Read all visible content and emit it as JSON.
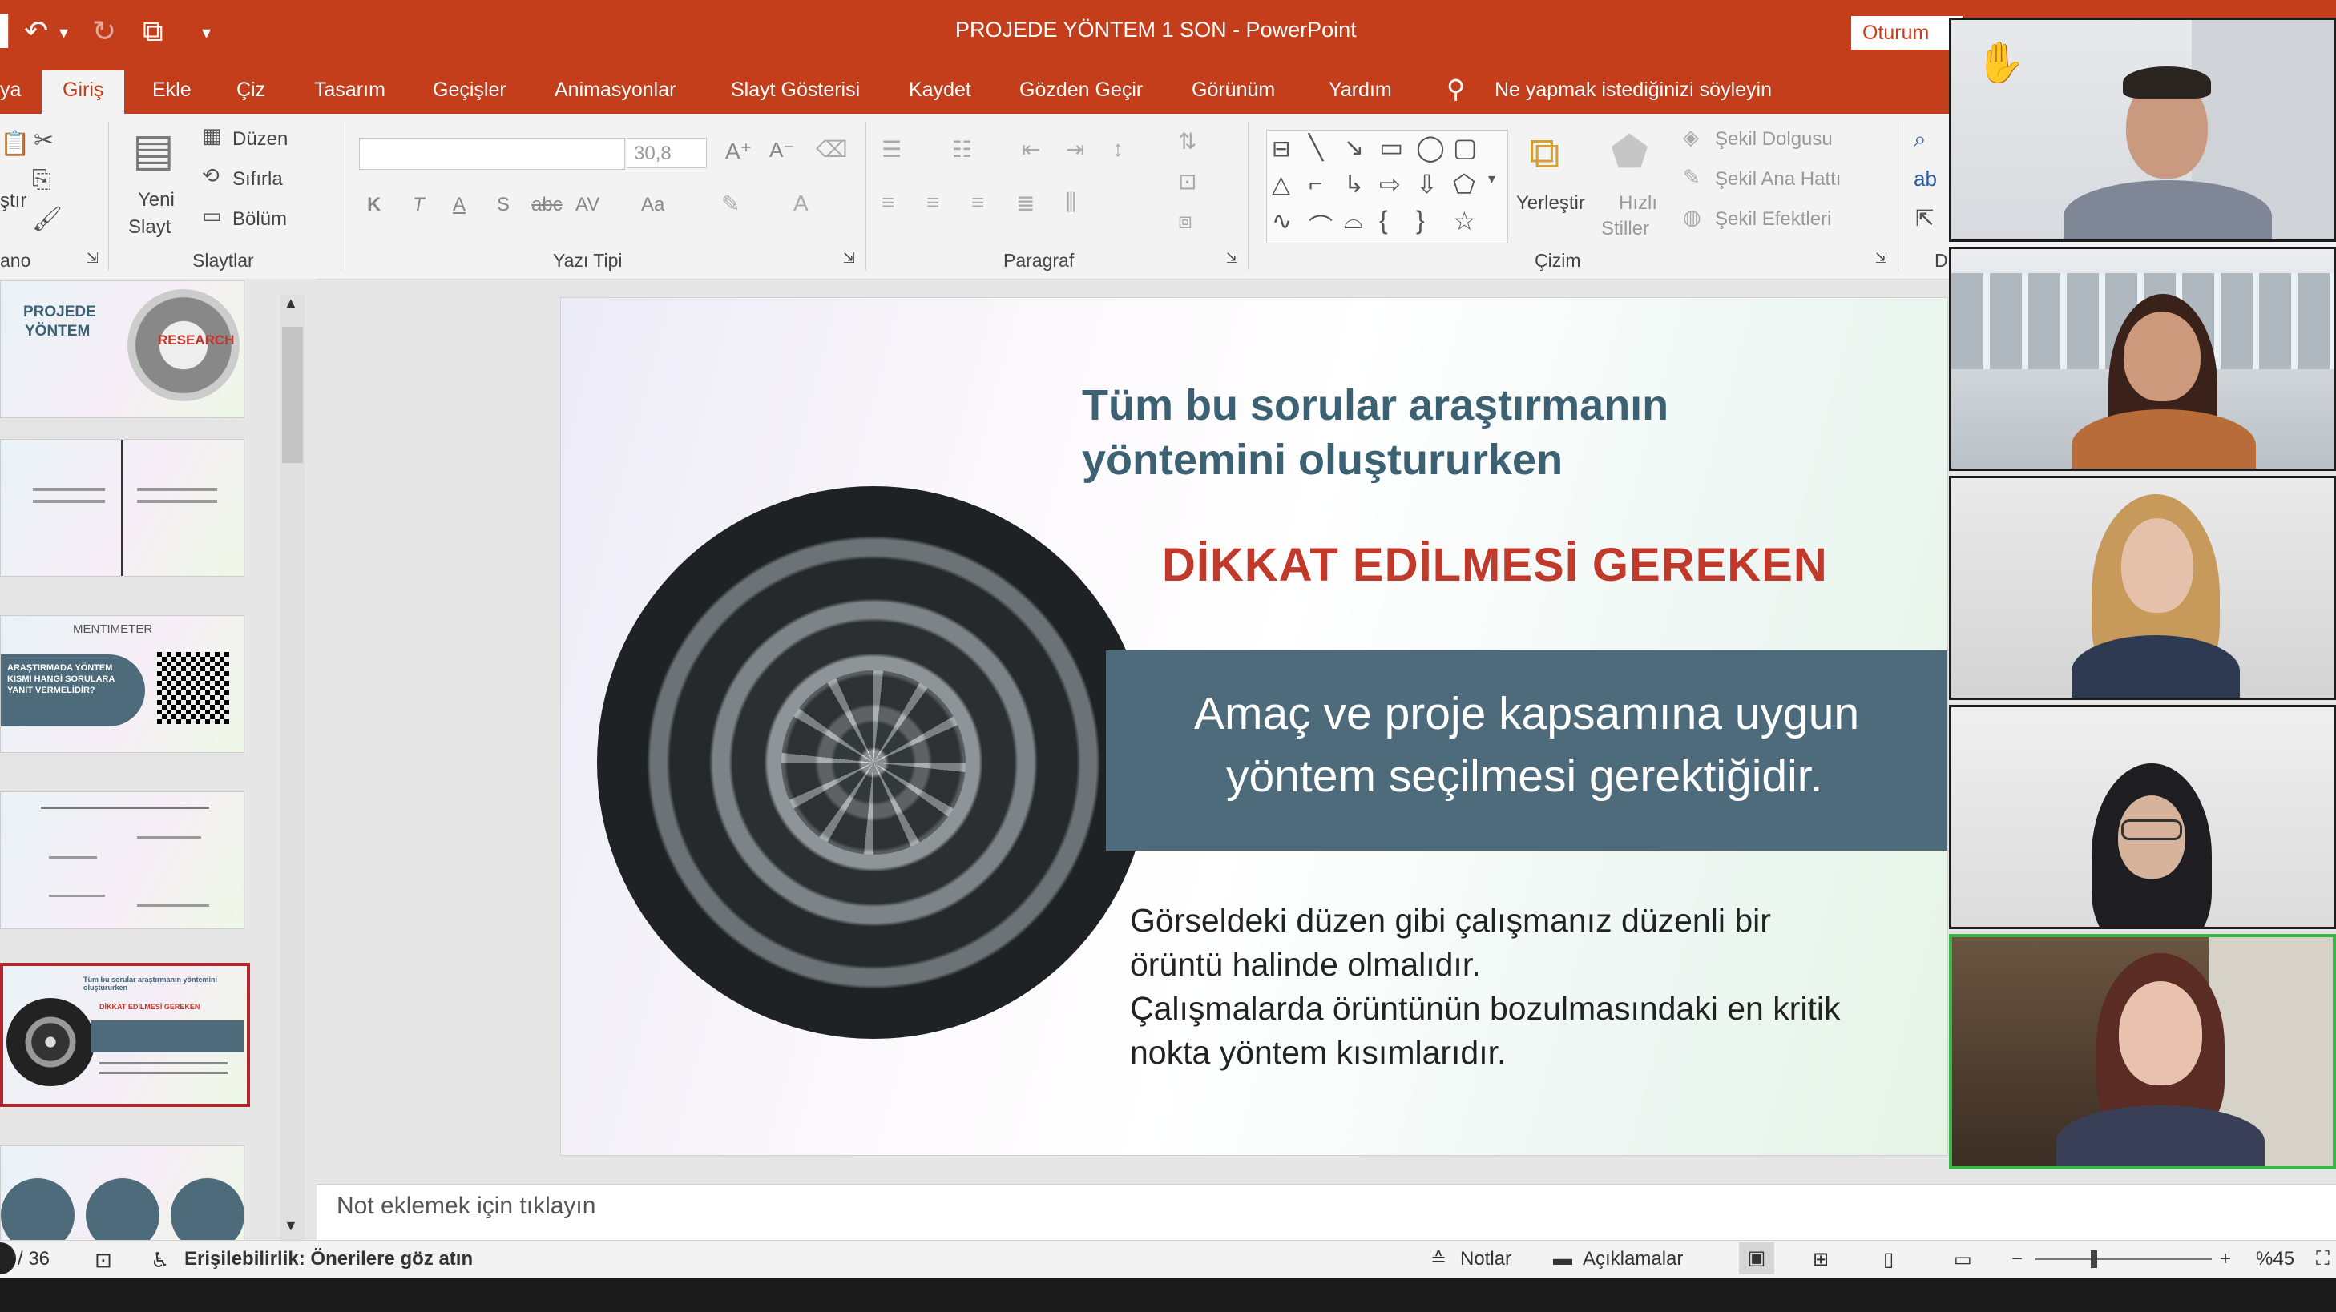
{
  "window": {
    "title": "PROJEDE YÖNTEM 1 SON  -  PowerPoint",
    "signin": "Oturum"
  },
  "tabs": [
    {
      "label": "ya"
    },
    {
      "label": "Giriş"
    },
    {
      "label": "Ekle"
    },
    {
      "label": "Çiz"
    },
    {
      "label": "Tasarım"
    },
    {
      "label": "Geçişler"
    },
    {
      "label": "Animasyonlar"
    },
    {
      "label": "Slayt Gösterisi"
    },
    {
      "label": "Kaydet"
    },
    {
      "label": "Gözden Geçir"
    },
    {
      "label": "Görünüm"
    },
    {
      "label": "Yardım"
    }
  ],
  "tell_me": "Ne yapmak istediğinizi söyleyin",
  "ribbon": {
    "clipboard": {
      "paste": "ştır",
      "group": "ano"
    },
    "slides": {
      "new_slide_1": "Yeni",
      "new_slide_2": "Slayt",
      "layout": "Düzen",
      "reset": "Sıfırla",
      "section": "Bölüm",
      "group": "Slaytlar"
    },
    "font": {
      "size": "30,8",
      "group": "Yazı Tipi",
      "bold": "K",
      "italic": "T",
      "underline": "A",
      "shadow": "S",
      "strike": "abc",
      "spacing": "AV",
      "case": "Aa"
    },
    "paragraph": {
      "group": "Paragraf"
    },
    "drawing": {
      "arrange": "Yerleştir",
      "quick_styles_1": "Hızlı",
      "quick_styles_2": "Stiller",
      "fill": "Şekil Dolgusu",
      "outline": "Şekil Ana Hattı",
      "effects": "Şekil Efektleri",
      "group": "Çizim"
    },
    "editing": {
      "group": "D"
    }
  },
  "thumbnails": [
    {
      "title_1": "PROJEDE",
      "title_2": "YÖNTEM",
      "badge": "RESEARCH"
    },
    {
      "title_1": "",
      "title_2": "",
      "badge": ""
    },
    {
      "title_1": "MENTIMETER",
      "title_2": "ARAŞTIRMADA YÖNTEM KISMI HANGİ SORULARA YANIT VERMELİDİR?",
      "badge": ""
    },
    {
      "title_1": "",
      "title_2": "",
      "badge": ""
    },
    {
      "title_1": "Tüm bu sorular araştırmanın yöntemini oluştururken",
      "title_2": "DİKKAT EDİLMESİ GEREKEN",
      "badge": ""
    },
    {
      "title_1": "",
      "title_2": "",
      "badge": ""
    }
  ],
  "slide": {
    "heading_1": "Tüm bu sorular araştırmanın",
    "heading_2": "yöntemini oluştururken",
    "red_heading": "DİKKAT EDİLMESİ GEREKEN",
    "banner_1": "Amaç ve proje kapsamına uygun",
    "banner_2": "yöntem seçilmesi gerektiğidir.",
    "body_1": "Görseldeki düzen gibi çalışmanız düzenli  bir",
    "body_2": "örüntü halinde olmalıdır.",
    "body_3": "Çalışmalarda örüntünün bozulmasındaki en kritik",
    "body_4": "nokta yöntem kısımlarıdır."
  },
  "notes": {
    "placeholder": "Not eklemek için tıklayın"
  },
  "status": {
    "slide_count": "/ 36",
    "accessibility": "Erişilebilirlik: Önerilere göz atın",
    "notes_btn": "Notlar",
    "comments_btn": "Açıklamalar",
    "zoom": "%45",
    "zoom_fraction": 0.33
  },
  "participants": {
    "count": 5,
    "active_index": 4,
    "raised_hand_index": 0
  },
  "colors": {
    "accent": "#c43e1c",
    "slide_heading": "#3b6173",
    "slide_red": "#c0392b",
    "banner": "#4e6b7b",
    "active_speaker": "#3ab54a"
  }
}
